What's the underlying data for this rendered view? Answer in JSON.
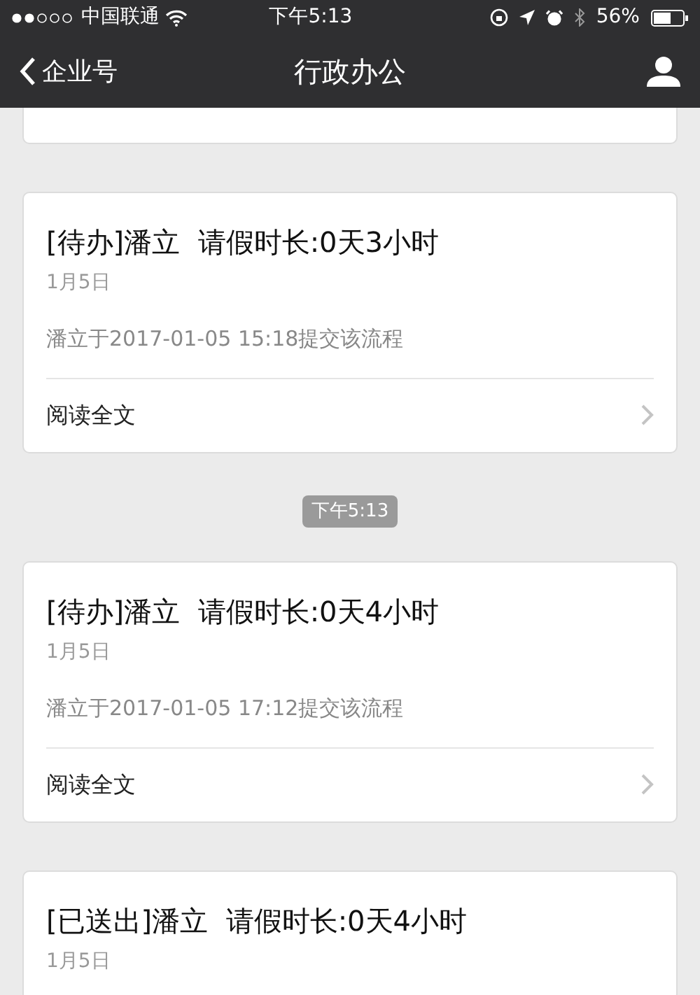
{
  "status_bar": {
    "carrier": "中国联通",
    "time": "下午5:13",
    "battery": "56%"
  },
  "nav": {
    "back": "企业号",
    "title": "行政办公"
  },
  "feed": [
    {
      "kind": "message"
    },
    {
      "kind": "message",
      "title": "[待办]潘立  请假时长:0天3小时",
      "date": "1月5日",
      "detail": "潘立于2017-01-05 15:18提交该流程",
      "link": "阅读全文"
    },
    {
      "kind": "time",
      "text": "下午5:13"
    },
    {
      "kind": "message",
      "title": "[待办]潘立  请假时长:0天4小时",
      "date": "1月5日",
      "detail": "潘立于2017-01-05 17:12提交该流程",
      "link": "阅读全文"
    },
    {
      "kind": "message",
      "title": "[已送出]潘立  请假时长:0天4小时",
      "date": "1月5日"
    }
  ]
}
